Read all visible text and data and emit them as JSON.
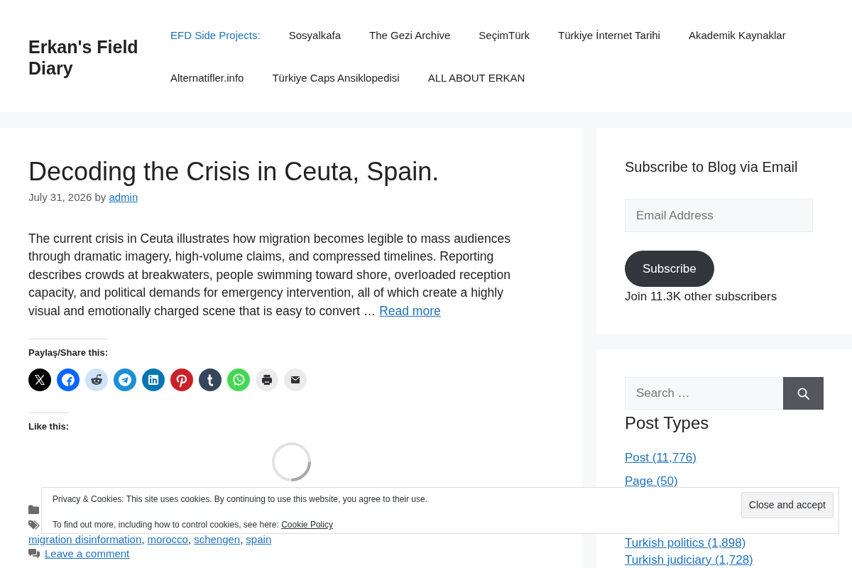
{
  "site": {
    "title": "Erkan's Field Diary"
  },
  "nav": {
    "items": [
      {
        "label": "EFD Side Projects:",
        "kind": "heading"
      },
      {
        "label": "Sosyalkafa",
        "kind": "link"
      },
      {
        "label": "The Gezi Archive",
        "kind": "link"
      },
      {
        "label": "SeçimTürk",
        "kind": "link"
      },
      {
        "label": "Türkiye İnternet Tarihi",
        "kind": "link"
      },
      {
        "label": "Akademik Kaynaklar",
        "kind": "link"
      },
      {
        "label": "Alternatifler.info",
        "kind": "link"
      },
      {
        "label": "Türkiye Caps Ansiklopedisi",
        "kind": "link"
      },
      {
        "label": "ALL ABOUT ERKAN",
        "kind": "link"
      }
    ]
  },
  "article": {
    "title": "Decoding the Crisis in Ceuta, Spain.",
    "date": "July 31, 2026",
    "byline": "by",
    "author": "admin",
    "excerpt": "The current crisis in Ceuta illustrates how migration becomes legible to mass audiences through dramatic imagery, high-volume claims, and compressed timelines. Reporting describes crowds at breakwaters, people swimming toward shore, overloaded reception capacity, and political demands for emergency intervention, all of which create a highly visual and emotionally charged scene that is easy to convert …",
    "read_more": "Read more",
    "share": {
      "heading": "Paylaş/Share this:",
      "buttons": [
        {
          "kind": "x"
        },
        {
          "kind": "facebook"
        },
        {
          "kind": "reddit"
        },
        {
          "kind": "telegram"
        },
        {
          "kind": "linkedin"
        },
        {
          "kind": "pinterest"
        },
        {
          "kind": "tumblr"
        },
        {
          "kind": "whatsapp"
        },
        {
          "kind": "print"
        },
        {
          "kind": "email"
        }
      ]
    },
    "likes": {
      "heading": "Like this:"
    },
    "footer": {
      "tags": [
        "migration disinformation",
        "morocco",
        "schengen",
        "spain"
      ],
      "tag_separator": ",",
      "comment_link": "Leave a comment"
    }
  },
  "sidebar": {
    "subscribe": {
      "title": "Subscribe to Blog via Email",
      "email_placeholder": "Email Address",
      "button": "Subscribe",
      "subscribers": "Join 11.3K other subscribers"
    },
    "search": {
      "placeholder": "Search …"
    },
    "post_types": {
      "title": "Post Types",
      "items": [
        "Post (11,776)",
        "Page (50)"
      ]
    },
    "more_links": [
      "Turkish politics (1,898)",
      "Turkish judiciary (1,728)"
    ]
  },
  "cookie_banner": {
    "text": "Privacy & Cookies: This site uses cookies. By continuing to use this website, you agree to their use.",
    "more_text": "To find out more, including how to control cookies, see here:",
    "policy_link": "Cookie Policy",
    "button": "Close and accept"
  }
}
